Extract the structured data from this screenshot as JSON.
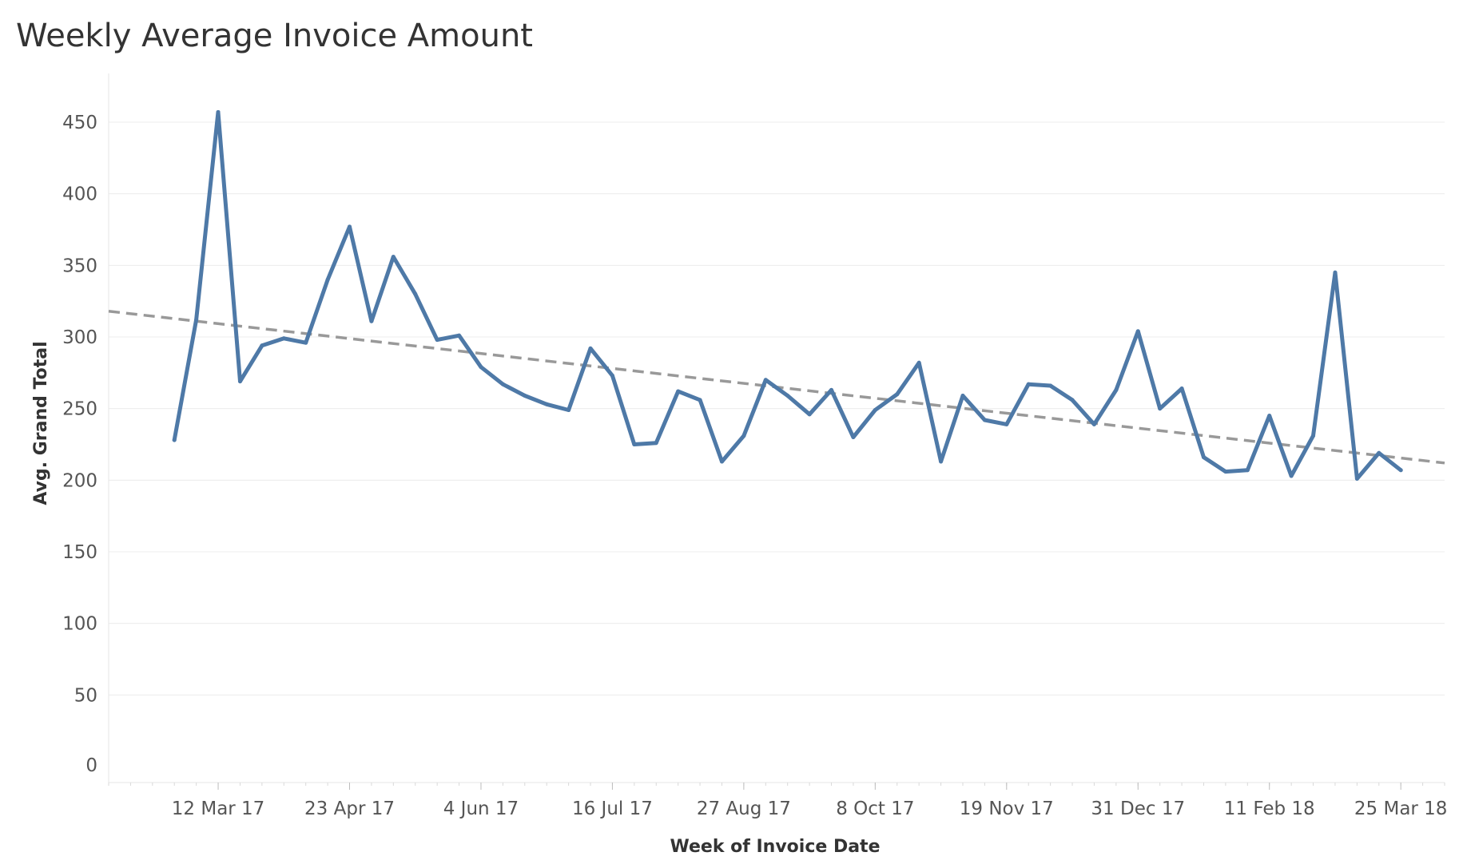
{
  "chart_data": {
    "type": "line",
    "title": "Weekly Average Invoice Amount",
    "xlabel": "Week of Invoice Date",
    "ylabel": "Avg. Grand Total",
    "ylim": [
      0,
      460
    ],
    "y_ticks": [
      0,
      50,
      100,
      150,
      200,
      250,
      300,
      350,
      400,
      450
    ],
    "x_tick_labels": [
      "12 Mar 17",
      "23 Apr 17",
      "4 Jun 17",
      "16 Jul 17",
      "27 Aug 17",
      "8 Oct 17",
      "19 Nov 17",
      "31 Dec 17",
      "11 Feb 18",
      "25 Mar 18"
    ],
    "x_tick_dates": [
      "2017-03-12",
      "2017-04-23",
      "2017-06-04",
      "2017-07-16",
      "2017-08-27",
      "2017-10-08",
      "2017-11-19",
      "2017-12-31",
      "2018-02-11",
      "2018-03-25"
    ],
    "xlim": [
      "2017-02-05",
      "2018-04-08"
    ],
    "grid": true,
    "series": [
      {
        "color": "#4e79a7",
        "x": [
          "2017-02-26",
          "2017-03-05",
          "2017-03-12",
          "2017-03-19",
          "2017-03-26",
          "2017-04-02",
          "2017-04-09",
          "2017-04-16",
          "2017-04-23",
          "2017-04-30",
          "2017-05-07",
          "2017-05-14",
          "2017-05-21",
          "2017-05-28",
          "2017-06-04",
          "2017-06-11",
          "2017-06-18",
          "2017-06-25",
          "2017-07-02",
          "2017-07-09",
          "2017-07-16",
          "2017-07-23",
          "2017-07-30",
          "2017-08-06",
          "2017-08-13",
          "2017-08-20",
          "2017-08-27",
          "2017-09-03",
          "2017-09-10",
          "2017-09-17",
          "2017-09-24",
          "2017-10-01",
          "2017-10-08",
          "2017-10-15",
          "2017-10-22",
          "2017-10-29",
          "2017-11-05",
          "2017-11-12",
          "2017-11-19",
          "2017-11-26",
          "2017-12-03",
          "2017-12-10",
          "2017-12-17",
          "2017-12-24",
          "2017-12-31",
          "2018-01-07",
          "2018-01-14",
          "2018-01-21",
          "2018-01-28",
          "2018-02-04",
          "2018-02-11",
          "2018-02-18",
          "2018-02-25",
          "2018-03-04",
          "2018-03-11",
          "2018-03-18",
          "2018-03-25"
        ],
        "values": [
          228,
          312,
          457,
          269,
          294,
          299,
          296,
          340,
          377,
          311,
          356,
          330,
          298,
          301,
          279,
          267,
          259,
          253,
          249,
          292,
          273,
          225,
          226,
          262,
          256,
          213,
          231,
          270,
          259,
          246,
          263,
          230,
          249,
          260,
          282,
          213,
          259,
          242,
          239,
          267,
          266,
          256,
          239,
          263,
          304,
          250,
          264,
          216,
          206,
          207,
          245,
          203,
          231,
          345,
          201,
          219,
          207
        ]
      }
    ],
    "trend_line": {
      "color": "#999999",
      "style": "dashed",
      "x": [
        "2017-02-05",
        "2018-04-08"
      ],
      "values": [
        318,
        212
      ]
    }
  }
}
